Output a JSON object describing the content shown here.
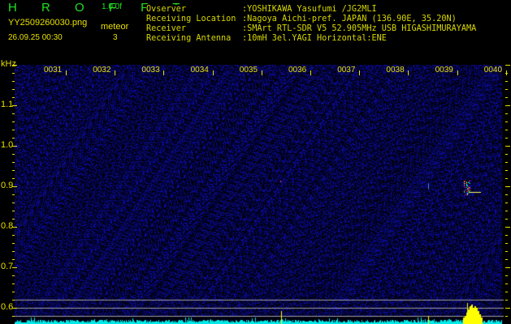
{
  "app": {
    "logo": "H R O F F T",
    "version": "1.0.0f"
  },
  "file": {
    "name": "YY2509260030.png",
    "datetime": "26.09.25 00:30"
  },
  "meteor": {
    "label": "meteor",
    "count": "3"
  },
  "info": [
    {
      "label": "Ovserver",
      "value": ":YOSHIKAWA Yasufumi /JG2MLI"
    },
    {
      "label": "Receiving Location",
      "value": ":Nagoya Aichi-pref. JAPAN (136.90E, 35.20N)"
    },
    {
      "label": "Receiver",
      "value": ":SMArt RTL-SDR V5 52.905MHz USB HIGASHIMURAYAMA"
    },
    {
      "label": "Receiving Antenna",
      "value": ":10mH 3el.YAGI Horizontal:ENE"
    }
  ],
  "axis": {
    "unit": "kHz",
    "time_labels": [
      "0031",
      "0032",
      "0033",
      "0034",
      "0035",
      "0036",
      "0037",
      "0038",
      "0039",
      "0040"
    ],
    "freq_labels": [
      "1.1",
      "1.0",
      "0.9",
      "0.8",
      "0.7",
      "0.6"
    ]
  },
  "colors": {
    "label": "#e8e000",
    "logo": "#22e022",
    "noise": "#1a1aa0",
    "baseline": "#00e8e8"
  }
}
